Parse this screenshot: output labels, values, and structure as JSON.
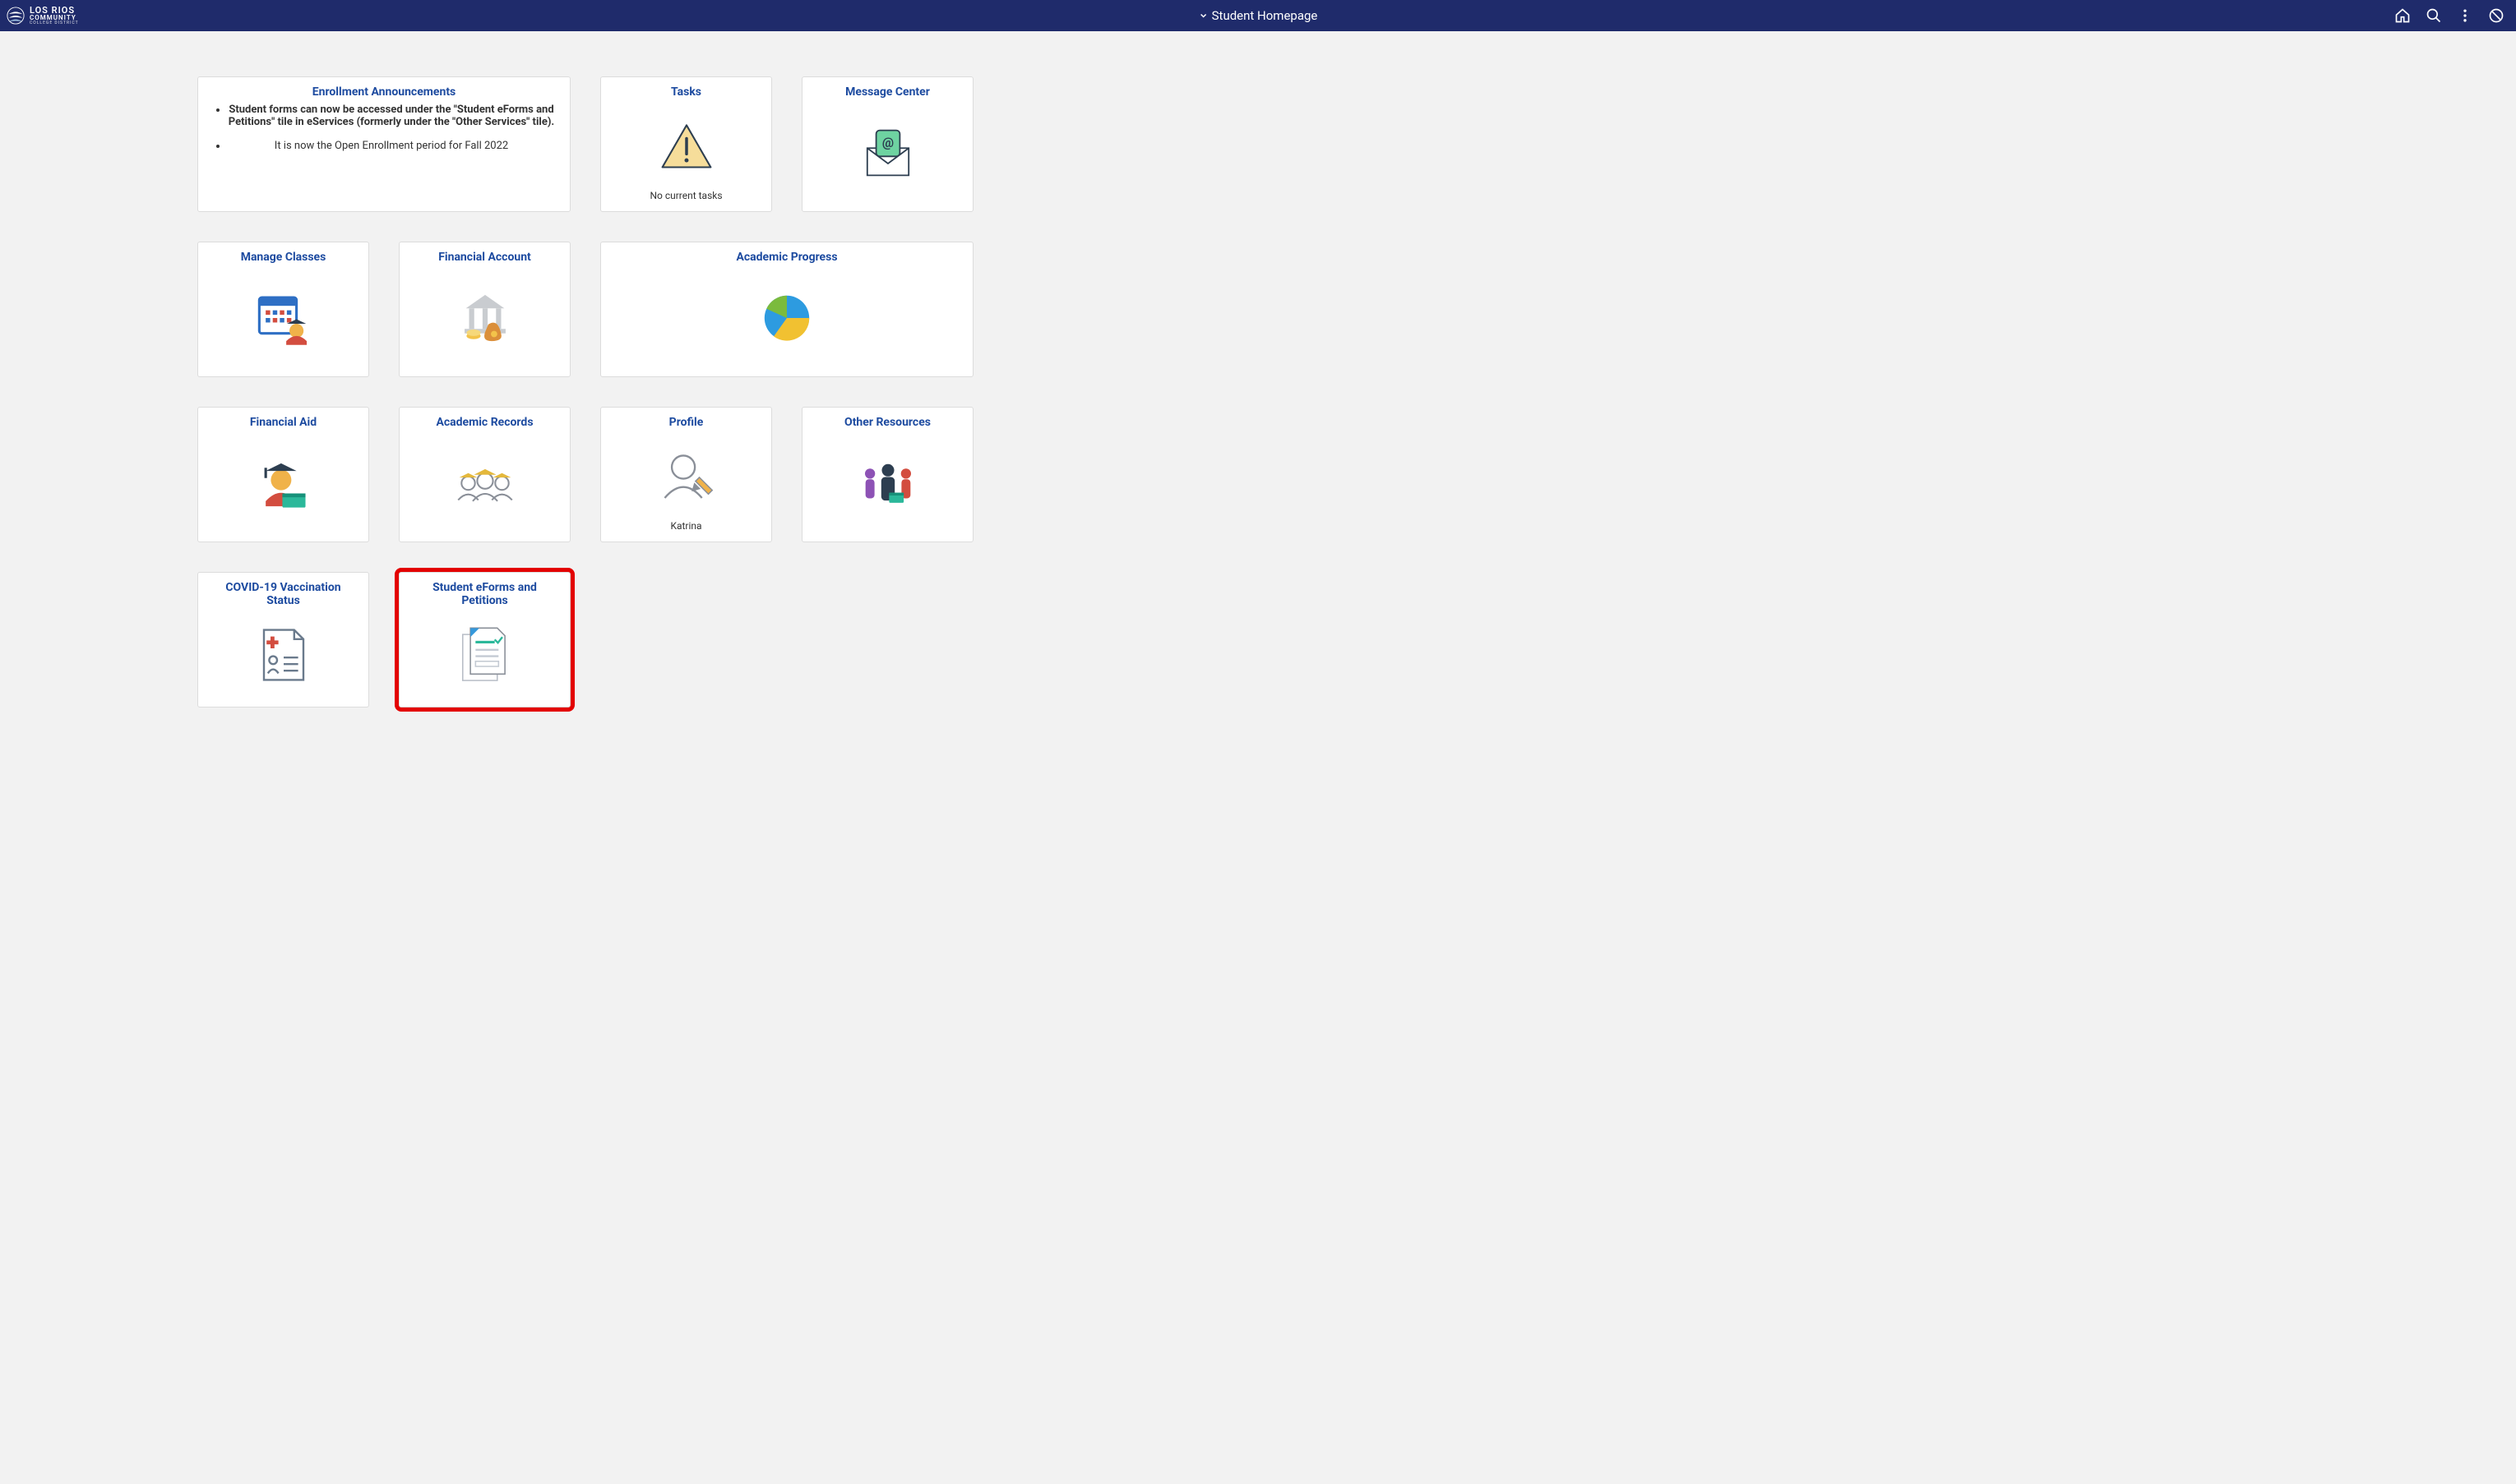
{
  "brand": {
    "line1": "LOS RIOS",
    "line2": "COMMUNITY",
    "line3": "COLLEGE DISTRICT"
  },
  "header": {
    "page_title": "Student Homepage"
  },
  "tiles": {
    "announcements": {
      "title": "Enrollment Announcements",
      "items": [
        "Student forms can now be accessed under the \"Student eForms and Petitions\" tile in eServices (formerly under the \"Other Services\" tile).",
        "It is now the Open Enrollment period for Fall 2022"
      ]
    },
    "tasks": {
      "title": "Tasks",
      "footer": "No current tasks"
    },
    "message_center": {
      "title": "Message Center"
    },
    "manage_classes": {
      "title": "Manage Classes"
    },
    "financial_account": {
      "title": "Financial Account"
    },
    "academic_progress": {
      "title": "Academic Progress"
    },
    "financial_aid": {
      "title": "Financial Aid"
    },
    "academic_records": {
      "title": "Academic Records"
    },
    "profile": {
      "title": "Profile",
      "footer": "Katrina"
    },
    "other_resources": {
      "title": "Other Resources"
    },
    "covid": {
      "title": "COVID-19 Vaccination Status"
    },
    "eforms": {
      "title": "Student eForms and Petitions"
    }
  }
}
